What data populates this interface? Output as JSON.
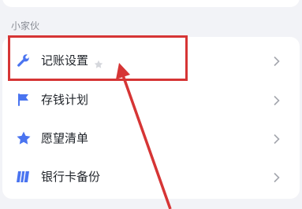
{
  "section": {
    "title": "小家伙"
  },
  "items": [
    {
      "label": "记账设置",
      "icon": "wrench-icon",
      "favorite_icon": "star-outline-icon"
    },
    {
      "label": "存钱计划",
      "icon": "flag-icon"
    },
    {
      "label": "愿望清单",
      "icon": "star-icon"
    },
    {
      "label": "银行卡备份",
      "icon": "card-icon"
    }
  ],
  "colors": {
    "accent": "#4a74f0",
    "highlight": "#d63535",
    "background": "#f2f3f7"
  }
}
